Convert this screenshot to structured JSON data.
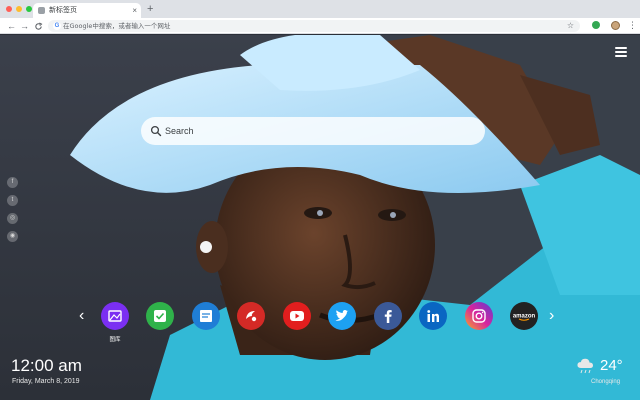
{
  "browser": {
    "tab_title": "新标签页",
    "tab_close": "×",
    "new_tab": "+",
    "back": "←",
    "forward": "→",
    "reload": "C",
    "google_letter": "G",
    "omnibox_placeholder": "在Google中搜索，或者输入一个网址",
    "bookmark_star": "☆",
    "menu": "⋮"
  },
  "search": {
    "placeholder": "Search"
  },
  "social_links": [
    {
      "name": "facebook",
      "glyph": "f"
    },
    {
      "name": "twitter",
      "glyph": "t"
    },
    {
      "name": "share",
      "glyph": "◎"
    },
    {
      "name": "wechat",
      "glyph": "◉"
    }
  ],
  "carousel": {
    "prev": "‹",
    "next": "›",
    "apps": [
      {
        "name": "gallery",
        "label": "图库",
        "color": "#7b2ff2"
      },
      {
        "name": "tasks",
        "label": "",
        "color": "#2fb24a"
      },
      {
        "name": "notes",
        "label": "",
        "color": "#1f7ed6"
      },
      {
        "name": "game",
        "label": "",
        "color": "#d42a26"
      },
      {
        "name": "youtube",
        "label": "",
        "color": "#e21e1e"
      },
      {
        "name": "twitter",
        "label": "",
        "color": "#1da1f2"
      },
      {
        "name": "facebook",
        "label": "",
        "color": "#3b5998"
      },
      {
        "name": "linkedin",
        "label": "",
        "color": "#0a66c2"
      },
      {
        "name": "instagram",
        "label": "",
        "color": "#d6249f"
      },
      {
        "name": "amazon",
        "label": "amazon",
        "color": "#222222"
      }
    ]
  },
  "clock": {
    "time": "12:00 am",
    "date": "Friday, March 8, 2019"
  },
  "weather": {
    "temp": "24°",
    "city": "Chongqing",
    "condition": "cloudy-rain"
  }
}
